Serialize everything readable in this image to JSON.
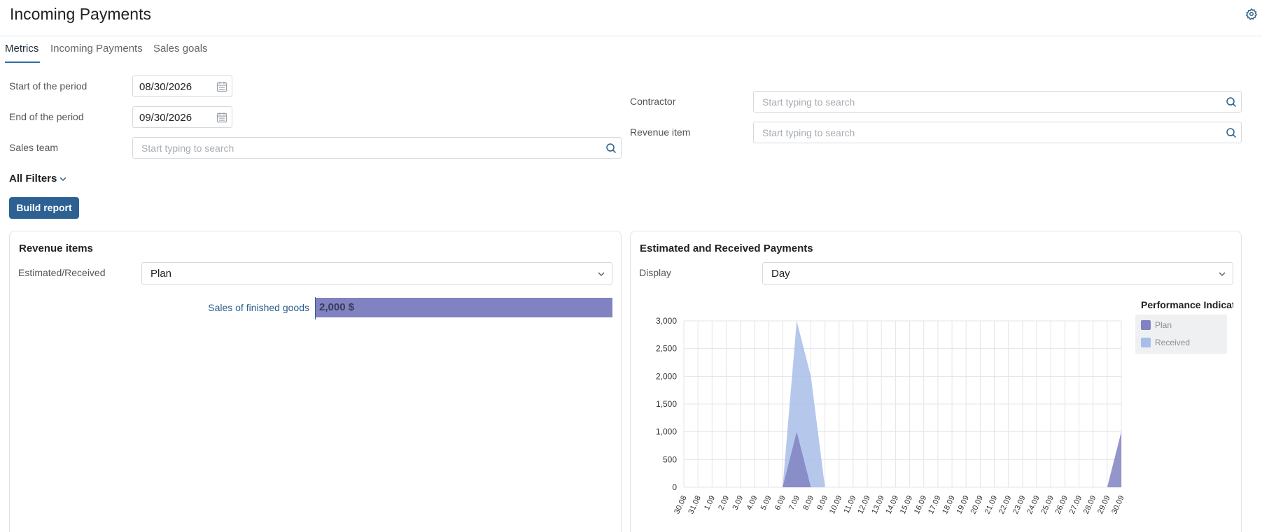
{
  "header": {
    "title": "Incoming Payments",
    "settings_icon": "gear-icon"
  },
  "tabs": [
    {
      "label": "Metrics",
      "active": true
    },
    {
      "label": "Incoming Payments",
      "active": false
    },
    {
      "label": "Sales goals",
      "active": false
    }
  ],
  "filters": {
    "start_label": "Start of the period",
    "start_value": "08/30/2026",
    "end_label": "End of the period",
    "end_value": "09/30/2026",
    "sales_team_label": "Sales team",
    "sales_team_placeholder": "Start typing to search",
    "contractor_label": "Contractor",
    "contractor_placeholder": "Start typing to search",
    "revenue_item_label": "Revenue item",
    "revenue_item_placeholder": "Start typing to search",
    "all_filters_label": "All Filters",
    "build_button": "Build report"
  },
  "revenue_panel": {
    "title": "Revenue items",
    "selector_label": "Estimated/Received",
    "selector_value": "Plan"
  },
  "payments_panel": {
    "title": "Estimated and Received Payments",
    "display_label": "Display",
    "display_value": "Day",
    "legend_title": "Performance Indicato"
  },
  "colors": {
    "accent": "#2e6193",
    "plan": "#8182c2",
    "received": "#a9bde9"
  },
  "chart_data": [
    {
      "type": "bar",
      "orientation": "horizontal",
      "categories": [
        "Sales of finished goods"
      ],
      "values": [
        2000
      ],
      "value_labels": [
        "2,000 $"
      ],
      "title": "",
      "xlabel": "",
      "ylabel": ""
    },
    {
      "type": "area",
      "x": [
        "30.08",
        "31.08",
        "1.09",
        "2.09",
        "3.09",
        "4.09",
        "5.09",
        "6.09",
        "7.09",
        "8.09",
        "9.09",
        "10.09",
        "11.09",
        "12.09",
        "13.09",
        "14.09",
        "15.09",
        "16.09",
        "17.09",
        "18.09",
        "19.09",
        "20.09",
        "21.09",
        "22.09",
        "23.09",
        "24.09",
        "25.09",
        "26.09",
        "27.09",
        "28.09",
        "29.09",
        "30.09"
      ],
      "yticks": [
        "0",
        "500",
        "1,000",
        "1,500",
        "2,000",
        "2,500",
        "3,000"
      ],
      "ylim": [
        0,
        3000
      ],
      "grid": true,
      "legend_position": "right",
      "series": [
        {
          "name": "Received",
          "color": "#a9bde9",
          "values": [
            0,
            0,
            0,
            0,
            0,
            0,
            0,
            0,
            3000,
            2000,
            0,
            0,
            0,
            0,
            0,
            0,
            0,
            0,
            0,
            0,
            0,
            0,
            0,
            0,
            0,
            0,
            0,
            0,
            0,
            0,
            0,
            0
          ]
        },
        {
          "name": "Plan",
          "color": "#8182c2",
          "values": [
            0,
            0,
            0,
            0,
            0,
            0,
            0,
            0,
            1000,
            0,
            0,
            0,
            0,
            0,
            0,
            0,
            0,
            0,
            0,
            0,
            0,
            0,
            0,
            0,
            0,
            0,
            0,
            0,
            0,
            0,
            0,
            1000
          ]
        }
      ]
    }
  ]
}
